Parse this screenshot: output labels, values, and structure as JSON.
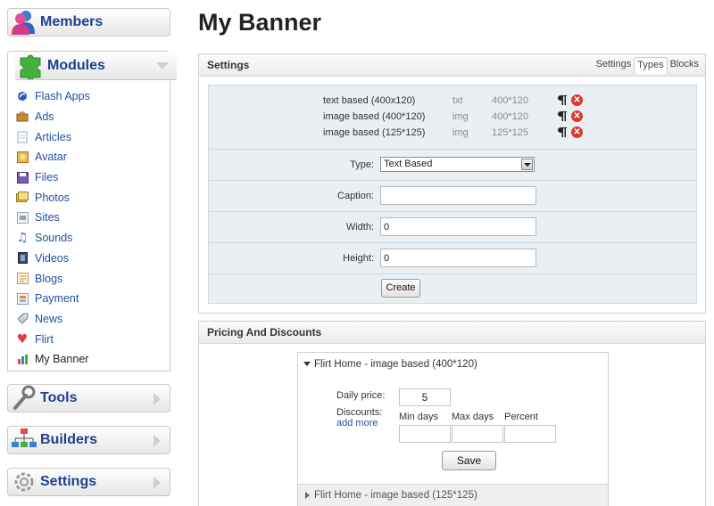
{
  "sidebar": {
    "members": {
      "label": "Members"
    },
    "modules": {
      "label": "Modules",
      "items": [
        {
          "label": "Flash Apps",
          "icon": "flash-icon"
        },
        {
          "label": "Ads",
          "icon": "briefcase-icon"
        },
        {
          "label": "Articles",
          "icon": "document-icon"
        },
        {
          "label": "Avatar",
          "icon": "avatar-icon"
        },
        {
          "label": "Files",
          "icon": "floppy-icon"
        },
        {
          "label": "Photos",
          "icon": "photos-icon"
        },
        {
          "label": "Sites",
          "icon": "sites-icon"
        },
        {
          "label": "Sounds",
          "icon": "music-note-icon"
        },
        {
          "label": "Videos",
          "icon": "film-icon"
        },
        {
          "label": "Blogs",
          "icon": "blog-icon"
        },
        {
          "label": "Payment",
          "icon": "payment-icon"
        },
        {
          "label": "News",
          "icon": "tag-icon"
        },
        {
          "label": "Flirt",
          "icon": "heart-icon"
        },
        {
          "label": "My Banner",
          "icon": "bar-chart-icon"
        }
      ]
    },
    "tools": {
      "label": "Tools"
    },
    "builders": {
      "label": "Builders"
    },
    "settings": {
      "label": "Settings"
    }
  },
  "page": {
    "title": "My Banner"
  },
  "settings_panel": {
    "title": "Settings",
    "tabs": [
      {
        "label": "Settings",
        "active": false
      },
      {
        "label": "Types",
        "active": true
      },
      {
        "label": "Blocks",
        "active": false
      }
    ],
    "types": [
      {
        "name": "text based (400x120)",
        "kind": "txt",
        "size": "400*120"
      },
      {
        "name": "image based (400*120)",
        "kind": "img",
        "size": "400*120"
      },
      {
        "name": "image based (125*125)",
        "kind": "img",
        "size": "125*125"
      }
    ],
    "form": {
      "type_label": "Type:",
      "type_value": "Text Based",
      "caption_label": "Caption:",
      "caption_value": "",
      "width_label": "Width:",
      "width_value": "0",
      "height_label": "Height:",
      "height_value": "0",
      "create_label": "Create"
    }
  },
  "pricing_panel": {
    "title": "Pricing And Discounts",
    "expanded_item": "Flirt Home - image based (400*120)",
    "daily_price_label": "Daily price:",
    "daily_price_value": "5",
    "discounts_label": "Discounts:",
    "add_more_label": "add more",
    "col_min_days": "Min days",
    "col_max_days": "Max days",
    "col_percent": "Percent",
    "save_label": "Save",
    "collapsed_item": "Flirt Home - image based (125*125)"
  },
  "colors": {
    "link": "#1f4f9f",
    "heading": "#1f3f8f",
    "delete": "#d93a2b"
  }
}
